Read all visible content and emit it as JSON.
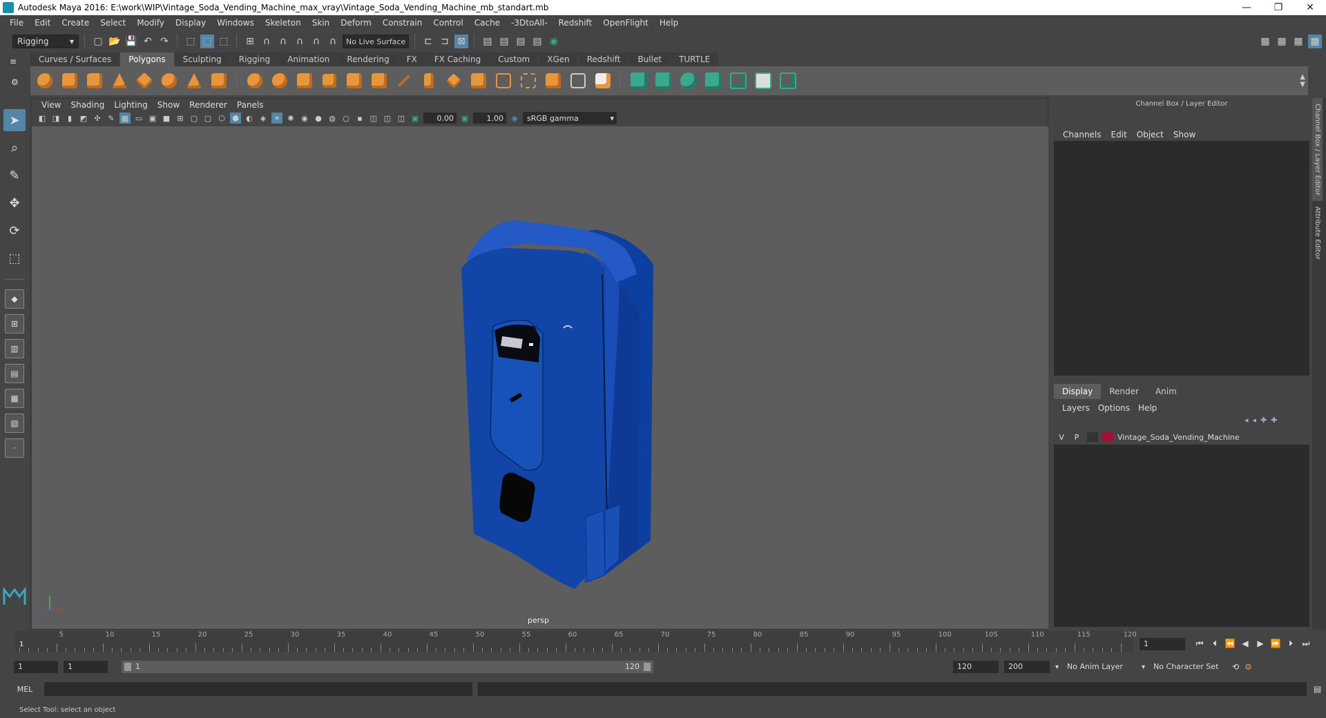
{
  "window": {
    "title": "Autodesk Maya 2016: E:\\work\\WIP\\Vintage_Soda_Vending_Machine_max_vray\\Vintage_Soda_Vending_Machine_mb_standart.mb",
    "minimize": "—",
    "maximize": "❐",
    "close": "✕"
  },
  "menubar": [
    "File",
    "Edit",
    "Create",
    "Select",
    "Modify",
    "Display",
    "Windows",
    "Skeleton",
    "Skin",
    "Deform",
    "Constrain",
    "Control",
    "Cache",
    "-3DtoAll-",
    "Redshift",
    "OpenFlight",
    "Help"
  ],
  "status": {
    "menu_set": "Rigging",
    "live_surface": "No Live Surface"
  },
  "shelf": {
    "tabs": [
      "Curves / Surfaces",
      "Polygons",
      "Sculpting",
      "Rigging",
      "Animation",
      "Rendering",
      "FX",
      "FX Caching",
      "Custom",
      "XGen",
      "Redshift",
      "Bullet",
      "TURTLE"
    ],
    "active_tab": "Polygons"
  },
  "viewport": {
    "menus": [
      "View",
      "Shading",
      "Lighting",
      "Show",
      "Renderer",
      "Panels"
    ],
    "exposure": "0.00",
    "gamma_value": "1.00",
    "color_space": "sRGB gamma",
    "camera": "persp"
  },
  "channel_box": {
    "title": "Channel Box / Layer Editor",
    "menus": [
      "Channels",
      "Edit",
      "Object",
      "Show"
    ]
  },
  "layer_editor": {
    "tabs": [
      "Display",
      "Render",
      "Anim"
    ],
    "active_tab": "Display",
    "menus": [
      "Layers",
      "Options",
      "Help"
    ],
    "layers": [
      {
        "v": "V",
        "p": "P",
        "name": "Vintage_Soda_Vending_Machine",
        "color": "#a21238"
      }
    ]
  },
  "side_tabs": [
    "Channel Box / Layer Editor",
    "Attribute Editor"
  ],
  "timeline": {
    "ticks": [
      "5",
      "10",
      "15",
      "20",
      "25",
      "30",
      "35",
      "40",
      "45",
      "50",
      "55",
      "60",
      "65",
      "70",
      "75",
      "80",
      "85",
      "90",
      "95",
      "100",
      "105",
      "110",
      "115",
      "120"
    ],
    "current_frame_label": "1",
    "current_frame": "1"
  },
  "range": {
    "start": "1",
    "playback_start": "1",
    "slider_left": "1",
    "slider_right": "120",
    "playback_end": "120",
    "end": "200",
    "anim_layer": "No Anim Layer",
    "character_set": "No Character Set"
  },
  "command": {
    "language": "MEL"
  },
  "help_line": "Select Tool: select an object",
  "colors": {
    "model_blue": "#1146a8",
    "viewport_bg": "#5d5d5d",
    "accent_blue": "#5285a6",
    "shelf_orange": "#e8963c",
    "shelf_teal": "#3aa88c"
  }
}
